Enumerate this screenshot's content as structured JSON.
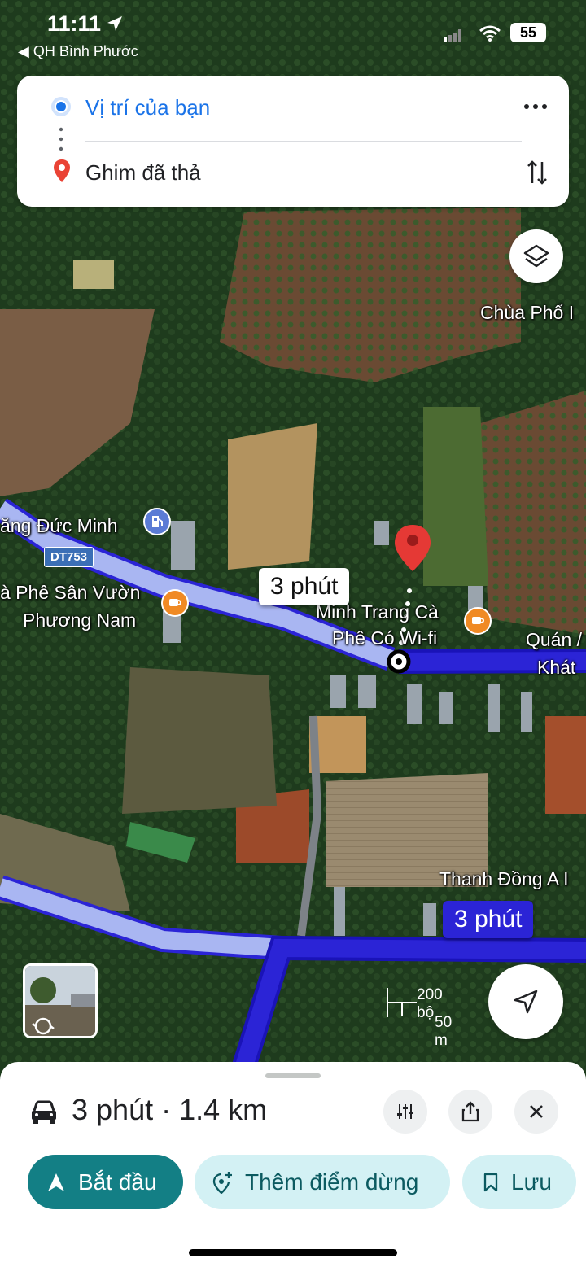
{
  "status_bar": {
    "time": "11:11",
    "back_app": "◀ QH Bình Phước",
    "battery": "55"
  },
  "directions": {
    "origin": "Vị trí của bạn",
    "destination": "Ghim đã thả",
    "more_icon": "more-vert-icon",
    "swap_icon": "swap-vertical-icon"
  },
  "map": {
    "labels": {
      "chua_pho": "Chùa Phổ I",
      "cang_duc_minh": "ăng Đức Minh",
      "ca_phe_san_vuon": "à Phê Sân Vườn",
      "phuong_nam": "Phương Nam",
      "minh_trang_1": "Minh Trang Cà",
      "minh_trang_2": "Phê Có Wi-fi",
      "quan_1": "Quán /",
      "quan_2": "Khát",
      "thanh_dong": "Thanh Đồng A I"
    },
    "road_shield": "DT753",
    "callout_alt": "3 phút",
    "callout_selected": "3 phút",
    "scale_imperial": "200 bộ",
    "scale_metric": "50 m",
    "colors": {
      "route_selected": "#2b24d6",
      "route_alt": "#a9b6f2",
      "pin": "#e53935",
      "cafe_poi": "#f08a24",
      "gas_poi": "#5b7bd5"
    }
  },
  "sheet": {
    "summary": "3 phút · 1.4 km",
    "start_label": "Bắt đầu",
    "add_stop_label": "Thêm điểm dừng",
    "save_label": "Lưu",
    "accent": "#137f85"
  }
}
